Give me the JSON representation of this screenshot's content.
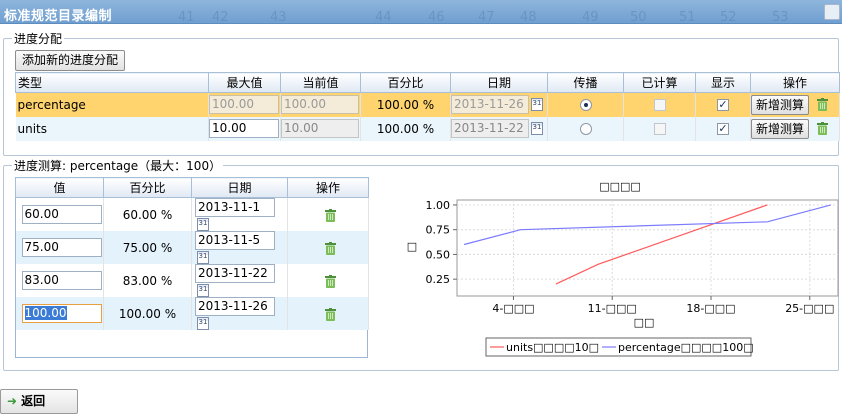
{
  "window": {
    "title": "标准规范目录编制",
    "ghost_numbers": [
      "41",
      "42",
      "43",
      "44",
      "45",
      "46",
      "47",
      "48",
      "49",
      "50",
      "51",
      "52",
      "53"
    ]
  },
  "allocation": {
    "legend": "进度分配",
    "add_button": "添加新的进度分配",
    "columns": [
      "类型",
      "最大值",
      "当前值",
      "百分比",
      "日期",
      "传播",
      "已计算",
      "显示",
      "操作"
    ],
    "rows": [
      {
        "type": "percentage",
        "max": "100.00",
        "current": "100.00",
        "percent": "100.00 %",
        "date": "2013-11-26",
        "propagate": true,
        "calculated": false,
        "show": true,
        "action": "新增测算"
      },
      {
        "type": "units",
        "max": "10.00",
        "current": "10.00",
        "percent": "100.00 %",
        "date": "2013-11-22",
        "propagate": false,
        "calculated": false,
        "show": true,
        "action": "新增测算"
      }
    ]
  },
  "measure": {
    "legend": "进度测算: percentage（最大：100）",
    "columns": [
      "值",
      "百分比",
      "日期",
      "操作"
    ],
    "rows": [
      {
        "value": "60.00",
        "percent": "60.00 %",
        "date": "2013-11-1"
      },
      {
        "value": "75.00",
        "percent": "75.00 %",
        "date": "2013-11-5"
      },
      {
        "value": "83.00",
        "percent": "83.00 %",
        "date": "2013-11-22"
      },
      {
        "value": "100.00",
        "percent": "100.00 %",
        "date": "2013-11-26"
      }
    ]
  },
  "back_button": "返回",
  "icons": {
    "calendar": "calendar-icon",
    "trash": "trash-icon",
    "back": "back-arrow-icon"
  },
  "colors": {
    "selected_row": "#ffd36e",
    "units_line": "#ff5a5a",
    "percentage_line": "#7b7bff"
  },
  "chart_data": {
    "type": "line",
    "title": "□□□□",
    "xlabel": "□□",
    "ylabel": "□",
    "x_ticks": [
      "4-□□□",
      "11-□□□",
      "18-□□□",
      "25-□□□"
    ],
    "y_ticks": [
      "0.25",
      "0.50",
      "0.75",
      "1.00"
    ],
    "xlim": [
      0,
      27
    ],
    "ylim": [
      0.08,
      1.05
    ],
    "grid": true,
    "legend_position": "bottom",
    "series": [
      {
        "name": "units□□□□10□",
        "color": "#ff5a5a",
        "x": [
          7,
          10,
          12,
          18,
          22
        ],
        "y": [
          0.2,
          0.4,
          0.5,
          0.8,
          1.0
        ]
      },
      {
        "name": "percentage□□□□100□",
        "color": "#7b7bff",
        "x": [
          0.5,
          4.5,
          22,
          26.5
        ],
        "y": [
          0.6,
          0.75,
          0.83,
          1.0
        ]
      }
    ]
  }
}
